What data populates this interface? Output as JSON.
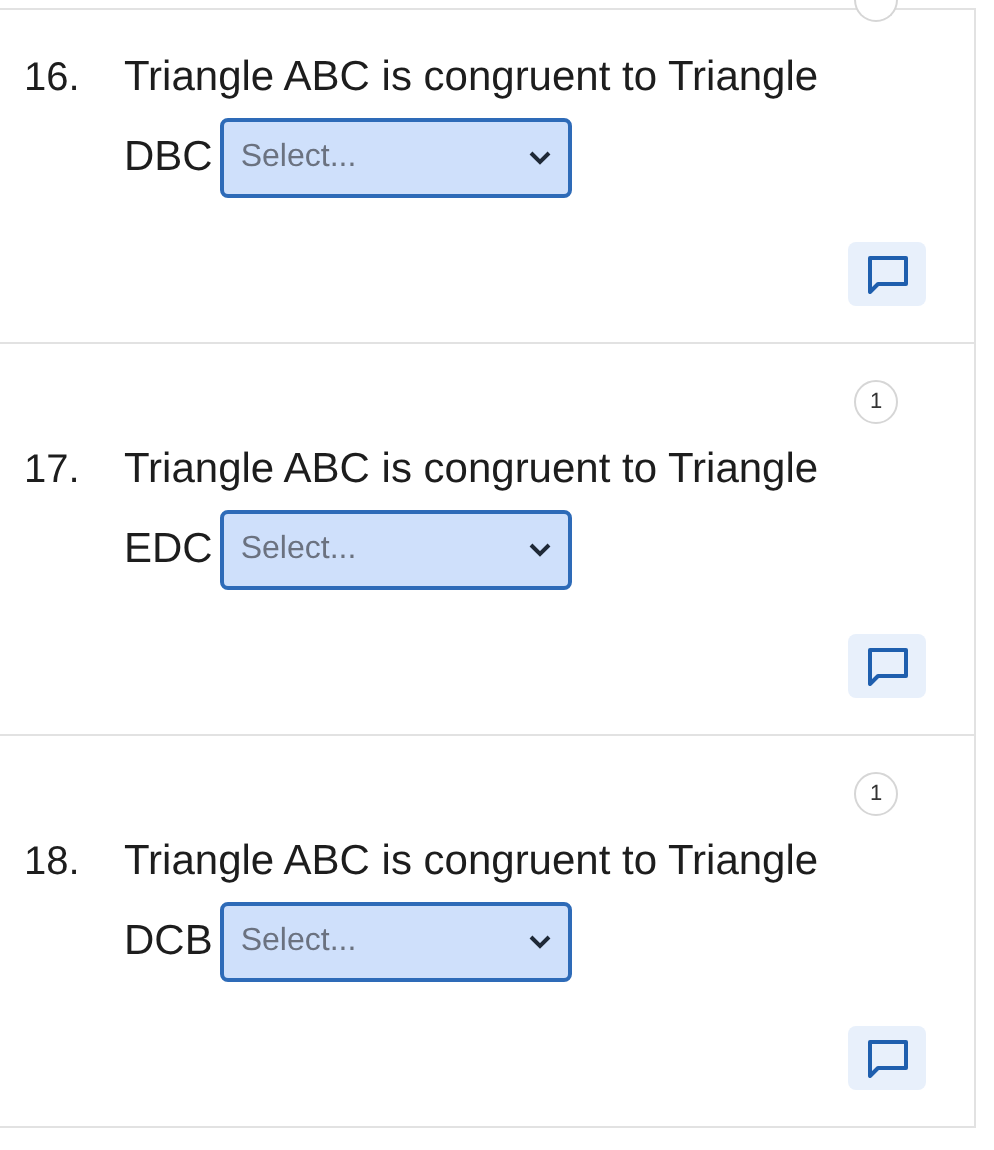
{
  "questions": [
    {
      "number": "16.",
      "text": "Triangle ABC is congruent to Triangle",
      "answer_label": "DBC",
      "dropdown": {
        "placeholder": "Select..."
      },
      "badge_partial": true
    },
    {
      "number": "17.",
      "text": "Triangle ABC is congruent to Triangle",
      "answer_label": "EDC",
      "dropdown": {
        "placeholder": "Select..."
      },
      "badge": "1"
    },
    {
      "number": "18.",
      "text": "Triangle ABC is congruent to Triangle",
      "answer_label": "DCB",
      "dropdown": {
        "placeholder": "Select..."
      },
      "badge": "1"
    }
  ]
}
